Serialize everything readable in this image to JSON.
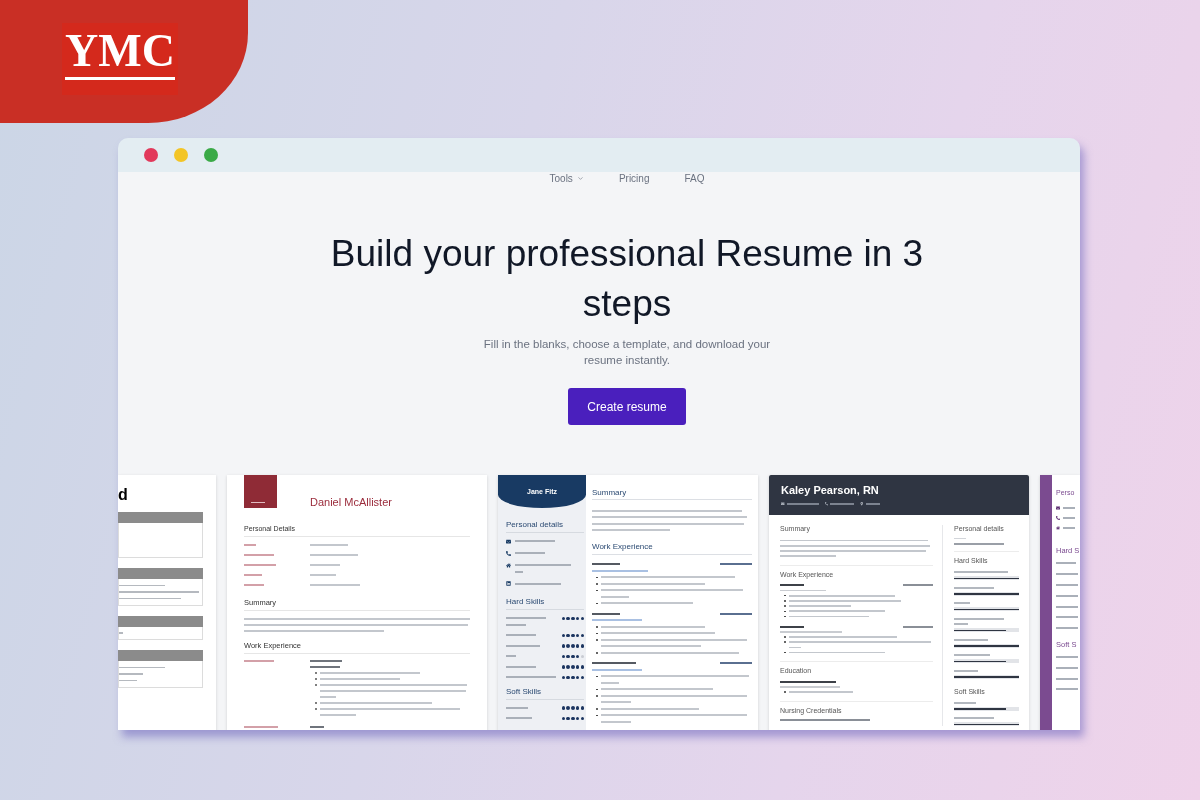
{
  "brand": {
    "logo_text": "YMC"
  },
  "window": {
    "controls": [
      {
        "color": "#e2395b"
      },
      {
        "color": "#f3c526"
      },
      {
        "color": "#3aaa47"
      }
    ]
  },
  "nav": [
    {
      "label": "Tools",
      "kind": "dropdown"
    },
    {
      "label": "Pricing",
      "kind": "link"
    },
    {
      "label": "FAQ",
      "kind": "link"
    }
  ],
  "hero": {
    "title": "Build your professional Resume in 3 steps",
    "subtitle": "Fill in the blanks, choose a template, and download your resume instantly.",
    "button": "Create resume"
  },
  "templates": [
    {
      "kind": "cropped",
      "heading": "d"
    },
    {
      "kind": "classic",
      "name": "Daniel McAllister",
      "details_title": "Personal Details",
      "summary_title": "Summary",
      "experience_title": "Work Experience"
    },
    {
      "kind": "sidebar",
      "name": "Jane Fitz",
      "details_title": "Personal details",
      "skill_groups": [
        {
          "title": "Hard Skills",
          "skills": [
            {
              "stars": 5
            },
            {
              "stars": 5
            },
            {
              "stars": 5
            },
            {
              "stars": 4
            },
            {
              "stars": 5
            },
            {
              "stars": 5
            }
          ]
        },
        {
          "title": "Soft Skills",
          "skills": [
            {
              "stars": 5
            },
            {
              "stars": 5
            }
          ]
        }
      ],
      "summary_title": "Summary",
      "experience_title": "Work Experience"
    },
    {
      "kind": "banner",
      "name": "Kaley Pearson, RN",
      "main": [
        {
          "kind": "paragraph",
          "title": "Summary"
        },
        {
          "kind": "jobs",
          "title": "Work Experience"
        },
        {
          "kind": "degree",
          "title": "Education"
        },
        {
          "kind": "credential",
          "title": "Nursing Credentials"
        }
      ],
      "side": [
        {
          "kind": "links",
          "title": "Personal details"
        },
        {
          "kind": "bars",
          "title": "Hard Skills",
          "skills": [
            {
              "level": 1
            },
            {
              "level": 1
            },
            {
              "level": 1
            },
            {
              "level": 0.8
            },
            {
              "level": 1
            },
            {
              "level": 0.8
            },
            {
              "level": 1
            }
          ]
        },
        {
          "kind": "bars",
          "title": "Soft Skills",
          "skills": [
            {
              "level": 0.8
            },
            {
              "level": 1
            }
          ]
        }
      ]
    },
    {
      "kind": "cropped-sidebar",
      "title": "Perso",
      "list_titles": [
        "Hard S",
        "Soft S"
      ]
    }
  ]
}
